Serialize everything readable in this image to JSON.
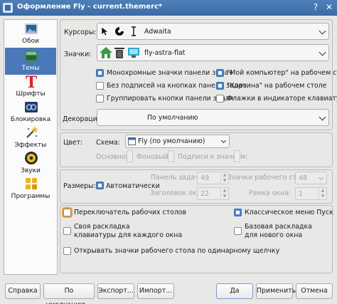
{
  "window": {
    "title": "Оформление Fly - current.themerc*",
    "help_glyph": "?",
    "close_glyph": "✕"
  },
  "sidebar": {
    "items": [
      {
        "label": "Обои",
        "icon": "wallpaper-icon"
      },
      {
        "label": "Темы",
        "icon": "themes-icon"
      },
      {
        "label": "Шрифты",
        "icon": "fonts-icon"
      },
      {
        "label": "Блокировка",
        "icon": "lock-icon"
      },
      {
        "label": "Эффекты",
        "icon": "effects-icon"
      },
      {
        "label": "Звуки",
        "icon": "sounds-icon"
      },
      {
        "label": "Программы",
        "icon": "programs-icon"
      }
    ],
    "active_index": 1
  },
  "themes": {
    "cursors_label": "Курсоры:",
    "cursors_value": "Adwaita",
    "icons_label": "Значки:",
    "icons_value": "fly-astra-flat",
    "checkboxes": [
      {
        "label": "Монохромные значки панели задач",
        "checked": true
      },
      {
        "label": "\"Мой компьютер\" на рабочем столе",
        "checked": true
      },
      {
        "label": "Без подписей на кнопках панели задач",
        "checked": false
      },
      {
        "label": "\"Корзина\" на рабочем столе",
        "checked": true
      },
      {
        "label": "Группировать кнопки панели задач",
        "checked": false
      },
      {
        "label": "Флажки в индикаторе клавиатуры",
        "checked": false
      }
    ],
    "decorations_label": "Декорации:",
    "decorations_value": "По умолчанию"
  },
  "color": {
    "label": "Цвет:",
    "scheme_label": "Схема:",
    "scheme_value": "Fly (по умолчанию)",
    "main_label": "Основной:",
    "background_label": "Фоновый:",
    "icon_caption_label": "Подписи к значкам:"
  },
  "sizes": {
    "label": "Размеры:",
    "auto_label": "Автоматически",
    "auto_checked": true,
    "taskbar_label": "Панель задач:",
    "taskbar_value": "49",
    "desktop_icons_label": "Значки рабочего стола:",
    "desktop_icons_value": "48",
    "window_title_label": "Заголовок окна:",
    "window_title_value": "22",
    "window_frame_label": "Рамка окна:",
    "window_frame_value": "1"
  },
  "options": [
    {
      "label": "Переключатель рабочих столов",
      "checked": false,
      "focused": true
    },
    {
      "label": "Классическое меню Пуск",
      "checked": true
    },
    {
      "label": "Своя раскладка",
      "label2": "клавиатуры для каждого окна",
      "checked": false
    },
    {
      "label": "Базовая раскладка",
      "label2": "для нового окна",
      "checked": false
    },
    {
      "label": "Открывать значки рабочего стола по одинарному щелчку",
      "checked": false
    }
  ],
  "buttons": {
    "help": "Справка",
    "defaults": "По умолчанию...",
    "export": "Экспорт...",
    "import": "Импорт...",
    "ok": "Да",
    "apply": "Применить",
    "cancel": "Отмена"
  },
  "colors": {
    "accent": "#4a78b8",
    "titlebar": "#3b6aa5",
    "checked": "#4a87cd",
    "focus_ring": "#f0a030"
  }
}
